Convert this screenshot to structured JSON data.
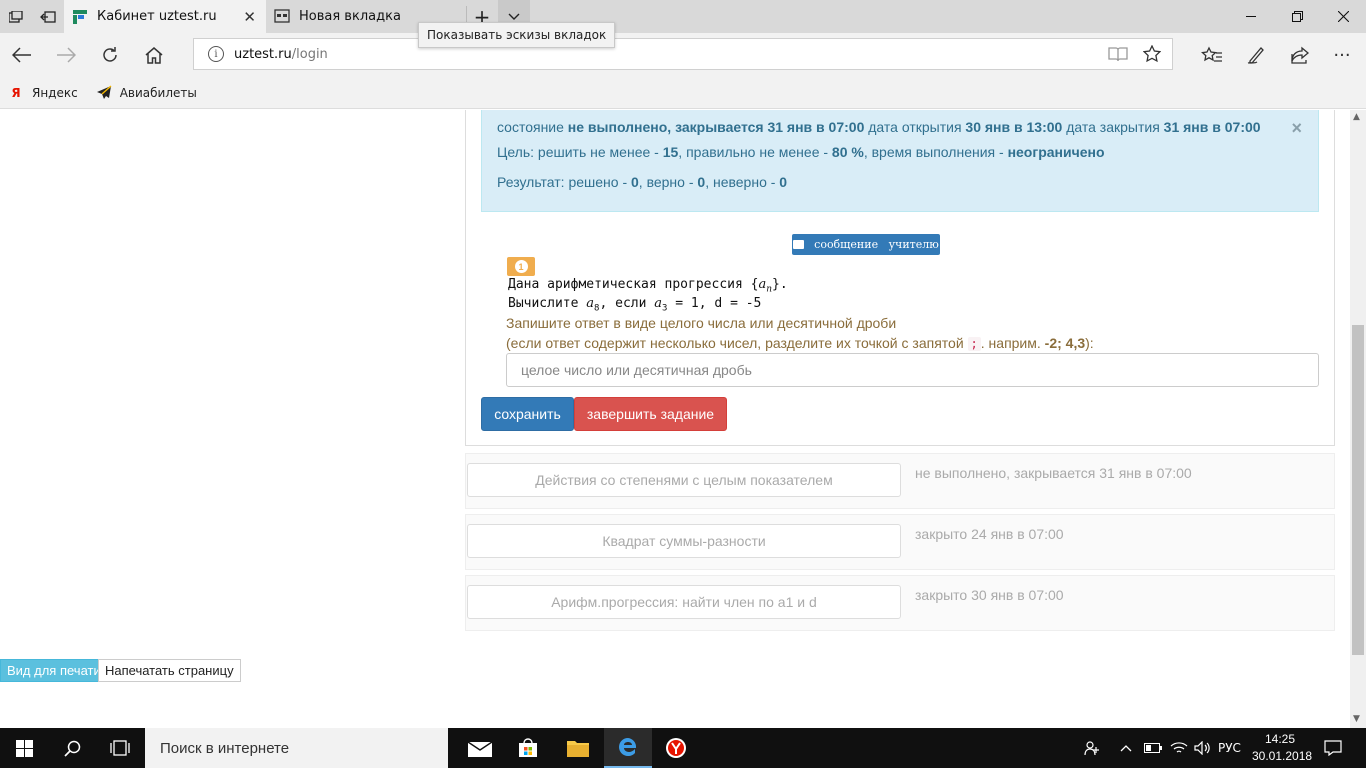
{
  "browser": {
    "tabs": [
      {
        "title": "Кабинет uztest.ru",
        "active": true
      },
      {
        "title": "Новая вкладка",
        "active": false
      }
    ],
    "tooltip": "Показывать эскизы вкладок",
    "address": {
      "host": "uztest.ru",
      "path": "/login"
    },
    "favorites": [
      {
        "label": "Яндекс",
        "icon": "yandex-icon"
      },
      {
        "label": "Авиабилеты",
        "icon": "plane-icon"
      }
    ]
  },
  "status_alert": {
    "state_label": "состояние",
    "state_value": "не выполнено, закрывается 31 янв в 07:00",
    "open_label": "дата открытия",
    "open_value": "30 янв в 13:00",
    "close_label": "дата закрытия",
    "close_value": "31 янв в 07:00",
    "goal_prefix": "Цель: решить не менее -",
    "goal_solve": "15",
    "goal_correct_label": ", правильно не менее -",
    "goal_correct": "80 %",
    "goal_time_label": ", время выполнения -",
    "goal_time": "неограничено",
    "result_prefix": "Результат: решено -",
    "result_solved": "0",
    "result_right_label": ", верно -",
    "result_right": "0",
    "result_wrong_label": ", неверно -",
    "result_wrong": "0"
  },
  "message_button": "сообщение   учителю",
  "task": {
    "number": "1",
    "line1": "Дана арифметическая прогрессия {",
    "line1_var": "a",
    "line1_sub": "n",
    "line1_end": "}.",
    "line2_a": "Вычислите ",
    "line2_var1": "a",
    "line2_sub1": "8",
    "line2_b": ", если ",
    "line2_var2": "a",
    "line2_sub2": "3",
    "line2_c": " = 1, d = -5",
    "hint1": "Запишите ответ в виде целого числа или десятичной дроби",
    "hint2_a": "(если ответ содержит несколько чисел, разделите их точкой с запятой ",
    "hint2_code": ";",
    "hint2_b": ". наприм. ",
    "hint2_example": "-2; 4,3",
    "hint2_c": "):",
    "answer_placeholder": "целое число или десятичная дробь",
    "save_label": "сохранить",
    "finish_label": "завершить задание"
  },
  "other_tasks": [
    {
      "title": "Действия со степенями с целым показателем",
      "status": "не выполнено, закрывается 31 янв в 07:00"
    },
    {
      "title": "Квадрат суммы-разности",
      "status": "закрыто 24 янв в 07:00"
    },
    {
      "title": "Арифм.прогрессия: найти член по а1 и d",
      "status": "закрыто 30 янв в 07:00"
    }
  ],
  "print": {
    "view_label": "Вид для печати",
    "print_label": "Напечатать страницу"
  },
  "taskbar": {
    "search_placeholder": "Поиск в интернете",
    "lang": "РУС",
    "time": "14:25",
    "date": "30.01.2018"
  },
  "colors": {
    "alert_bg": "#d9edf7",
    "primary": "#337ab7",
    "danger": "#d9534f",
    "warning": "#f0ad4e",
    "info": "#5bc0de"
  }
}
